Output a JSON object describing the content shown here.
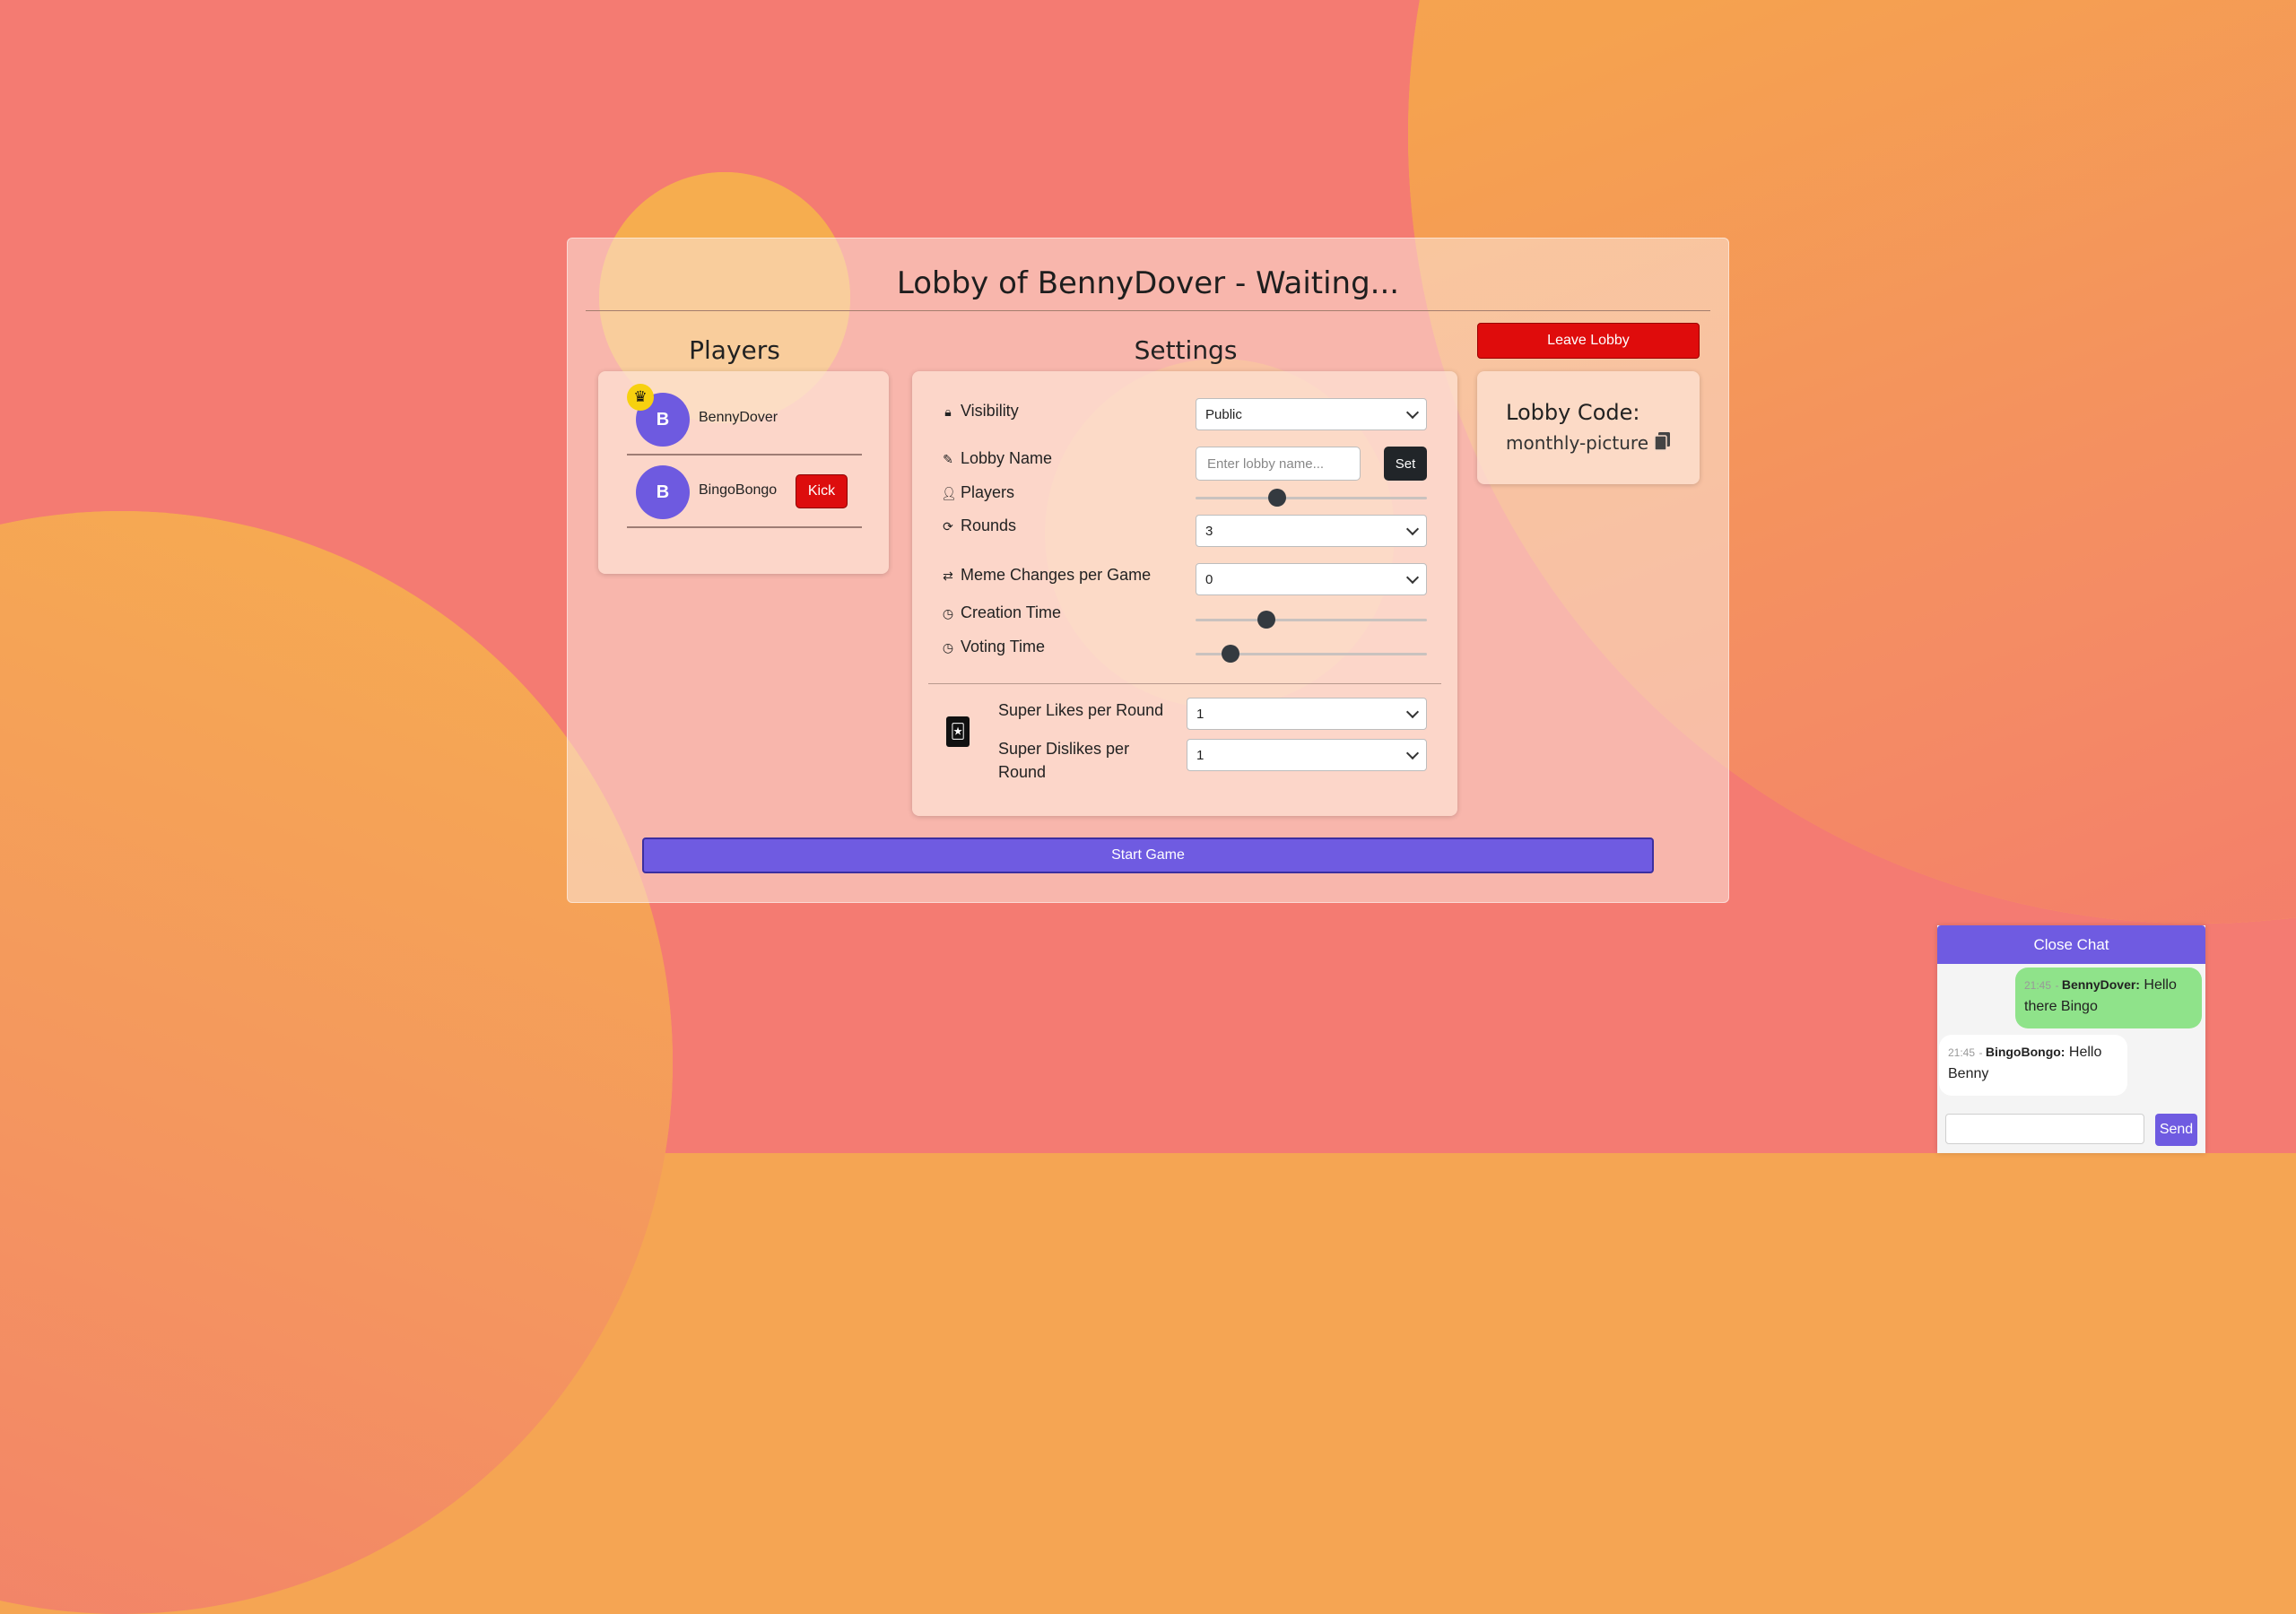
{
  "lobby": {
    "title": "Lobby of BennyDover - Waiting..."
  },
  "players": {
    "heading": "Players",
    "list": [
      {
        "initial": "B",
        "name": "BennyDover",
        "is_host": true
      },
      {
        "initial": "B",
        "name": "BingoBongo",
        "kick_label": "Kick"
      }
    ]
  },
  "settings": {
    "heading": "Settings",
    "visibility": {
      "label": "Visibility",
      "value": "Public"
    },
    "lobby_name": {
      "label": "Lobby Name",
      "placeholder": "Enter lobby name...",
      "set_label": "Set"
    },
    "players": {
      "label": "Players",
      "slider_fraction": 0.34
    },
    "rounds": {
      "label": "Rounds",
      "value": "3"
    },
    "meme_changes": {
      "label": "Meme Changes per Game",
      "value": "0"
    },
    "creation_time": {
      "label": "Creation Time",
      "slider_fraction": 0.29
    },
    "voting_time": {
      "label": "Voting Time",
      "slider_fraction": 0.12
    },
    "super_likes": {
      "label": "Super Likes per Round",
      "value": "1"
    },
    "super_dislikes": {
      "label": "Super Dislikes per Round",
      "value": "1"
    }
  },
  "actions": {
    "leave_label": "Leave Lobby",
    "start_label": "Start Game"
  },
  "lobby_code": {
    "heading": "Lobby Code:",
    "code": "monthly-picture"
  },
  "chat": {
    "close_label": "Close Chat",
    "send_label": "Send",
    "messages": [
      {
        "time": "21:45",
        "author": "BennyDover:",
        "text": "Hello there Bingo"
      },
      {
        "time": "21:45",
        "author": "BingoBongo:",
        "text": "Hello Benny"
      }
    ]
  },
  "colors": {
    "accent": "#6f5be1",
    "danger": "#df0c0c",
    "own_message": "#8fe38a"
  }
}
